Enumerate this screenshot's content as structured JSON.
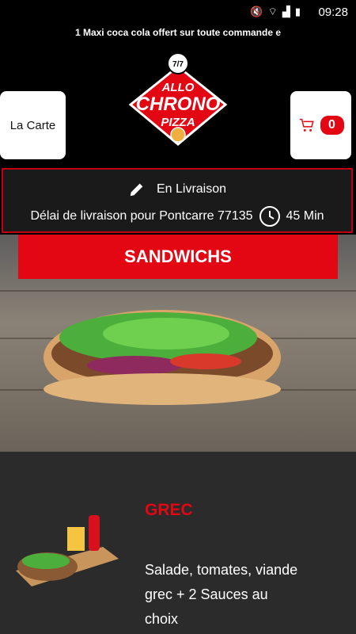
{
  "status_bar": {
    "time": "09:28"
  },
  "ticker": {
    "text": "1 Maxi coca cola offert sur toute commande e"
  },
  "header": {
    "carte_label": "La Carte",
    "cart_count": "0",
    "logo": {
      "line1": "ALLO",
      "line2": "CHRONO",
      "line3": "PIZZA",
      "clock_text": "7/7"
    }
  },
  "delivery": {
    "mode": "En Livraison",
    "delay_text": "Délai de livraison pour Pontcarre 77135",
    "delay_value": "45 Min"
  },
  "category": {
    "title": "SANDWICHS"
  },
  "items": [
    {
      "title": "GREC",
      "description": "Salade, tomates, viande grec + 2 Sauces au choix"
    }
  ],
  "colors": {
    "accent": "#e30613",
    "background": "#000000",
    "list_bg": "#2b2b2b"
  }
}
